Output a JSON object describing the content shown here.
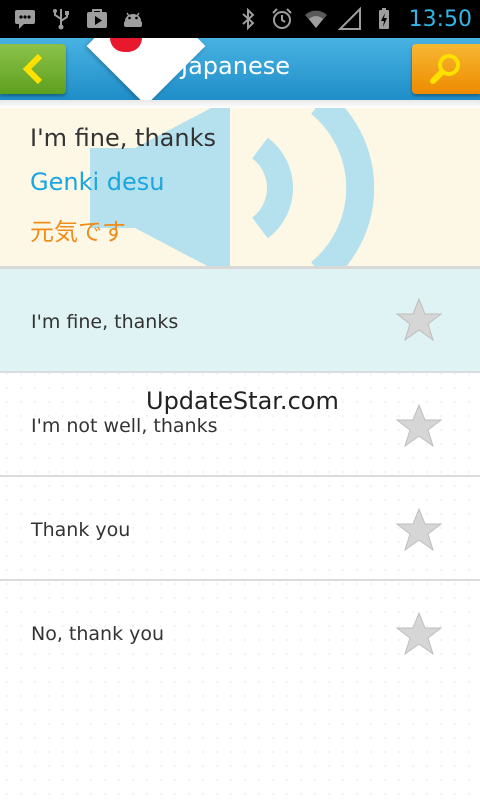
{
  "status_bar": {
    "time": "13:50",
    "icons_left": [
      "chat-icon",
      "usb-icon",
      "play-store-icon",
      "android-icon"
    ],
    "icons_right": [
      "bluetooth-icon",
      "alarm-icon",
      "wifi-icon",
      "signal-icon",
      "battery-charging-icon"
    ],
    "accent_color": "#33b5e5"
  },
  "action_bar": {
    "title": "Japanese",
    "back_icon": "chevron-left-icon",
    "search_icon": "search-icon",
    "flag": "japan-flag"
  },
  "phrase": {
    "english": "I'm fine, thanks",
    "romaji": "Genki desu",
    "japanese": "元気です",
    "speaker_icon": "speaker-icon"
  },
  "list": {
    "items": [
      {
        "label": "I'm fine, thanks",
        "selected": true
      },
      {
        "label": "I'm not well, thanks",
        "selected": false
      },
      {
        "label": "Thank you",
        "selected": false
      },
      {
        "label": "No, thank you",
        "selected": false
      }
    ]
  },
  "watermark": "UpdateStar.com"
}
